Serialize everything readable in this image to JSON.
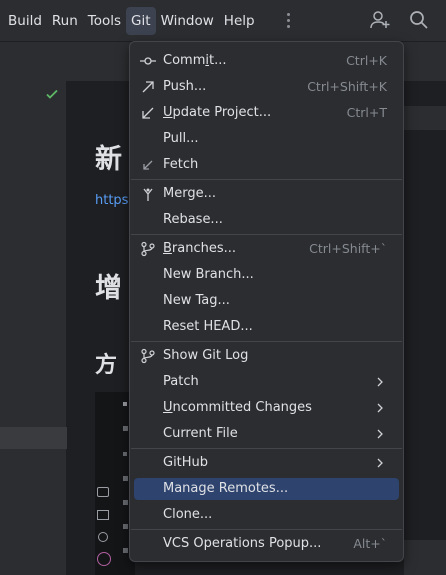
{
  "menubar": {
    "items": [
      "Build",
      "Run",
      "Tools",
      "Git",
      "Window",
      "Help"
    ],
    "active": "Git"
  },
  "editor": {
    "heading1": "新",
    "link": "https:",
    "heading2": "增",
    "heading3": "方"
  },
  "git_menu": {
    "items": [
      {
        "label": "Commit...",
        "shortcut": "Ctrl+K",
        "icon": "commit-icon"
      },
      {
        "label": "Push...",
        "shortcut": "Ctrl+Shift+K",
        "icon": "push-arrow-icon"
      },
      {
        "label": "Update Project...",
        "shortcut": "Ctrl+T",
        "icon": "update-arrow-icon"
      },
      {
        "label": "Pull...",
        "shortcut": "",
        "icon": ""
      },
      {
        "label": "Fetch",
        "shortcut": "",
        "icon": "fetch-arrow-icon"
      },
      {
        "label": "Merge...",
        "shortcut": "",
        "icon": "merge-icon"
      },
      {
        "label": "Rebase...",
        "shortcut": "",
        "icon": ""
      },
      {
        "label": "Branches...",
        "shortcut": "Ctrl+Shift+`",
        "icon": "branch-icon"
      },
      {
        "label": "New Branch...",
        "shortcut": "",
        "icon": ""
      },
      {
        "label": "New Tag...",
        "shortcut": "",
        "icon": ""
      },
      {
        "label": "Reset HEAD...",
        "shortcut": "",
        "icon": ""
      },
      {
        "label": "Show Git Log",
        "shortcut": "",
        "icon": "git-log-icon"
      },
      {
        "label": "Patch",
        "shortcut": "",
        "icon": "",
        "submenu": true
      },
      {
        "label": "Uncommitted Changes",
        "shortcut": "",
        "icon": "",
        "submenu": true
      },
      {
        "label": "Current File",
        "shortcut": "",
        "icon": "",
        "submenu": true
      },
      {
        "label": "GitHub",
        "shortcut": "",
        "icon": "",
        "submenu": true
      },
      {
        "label": "Manage Remotes...",
        "shortcut": "",
        "icon": "",
        "highlighted": true
      },
      {
        "label": "Clone...",
        "shortcut": "",
        "icon": ""
      },
      {
        "label": "VCS Operations Popup...",
        "shortcut": "Alt+`",
        "icon": ""
      }
    ]
  },
  "colors": {
    "menu_bg": "#2b2d30",
    "highlight": "#2e436e",
    "shortcut_text": "#868a91",
    "link": "#589df6"
  }
}
